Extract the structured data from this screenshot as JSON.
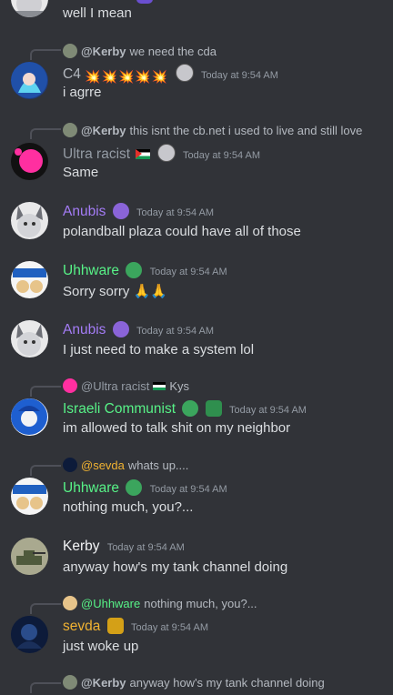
{
  "messages": [
    {
      "body": "well I mean"
    },
    {
      "reply": {
        "name": "@Kerby",
        "text": "we need the cda"
      },
      "name": "C4",
      "emoji": "💥💥💥💥💥",
      "ts": "Today at 9:54 AM",
      "body": "i agrre"
    },
    {
      "reply": {
        "name": "@Kerby",
        "text": "this isnt the cb.net i used to live and still love"
      },
      "name": "Ultra racist",
      "ts": "Today at 9:54 AM",
      "body": "Same"
    },
    {
      "name": "Anubis",
      "ts": "Today at 9:54 AM",
      "body": "polandball plaza could have all of those"
    },
    {
      "name": "Uhhware",
      "ts": "Today at 9:54 AM",
      "body": "Sorry sorry 🙏🙏"
    },
    {
      "name": "Anubis",
      "ts": "Today at 9:54 AM",
      "body": "I just need to make a system lol"
    },
    {
      "reply": {
        "name": "@Ultra racist",
        "text": "Kys"
      },
      "name": "Israeli Communist",
      "ts": "Today at 9:54 AM",
      "body": "im allowed to talk shit on my neighbor"
    },
    {
      "reply": {
        "name": "@sevda",
        "text": "whats up...."
      },
      "name": "Uhhware",
      "ts": "Today at 9:54 AM",
      "body": "nothing much, you?..."
    },
    {
      "name": "Kerby",
      "ts": "Today at 9:54 AM",
      "body": "anyway how's my tank channel doing"
    },
    {
      "reply": {
        "name": "@Uhhware",
        "text": "nothing much, you?..."
      },
      "name": "sevda",
      "ts": "Today at 9:54 AM",
      "body": "just woke up"
    },
    {
      "reply": {
        "name": "@Kerby",
        "text": "anyway how's my tank channel doing"
      }
    }
  ],
  "colors": {
    "background": "#313338",
    "c4": "#b5bac1",
    "ultra": "#949ba4",
    "anubis": "#a47cf6",
    "uhhware": "#57f287",
    "israeli": "#57f287",
    "kerby": "#f2f3f5",
    "sevda": "#f0b232"
  }
}
